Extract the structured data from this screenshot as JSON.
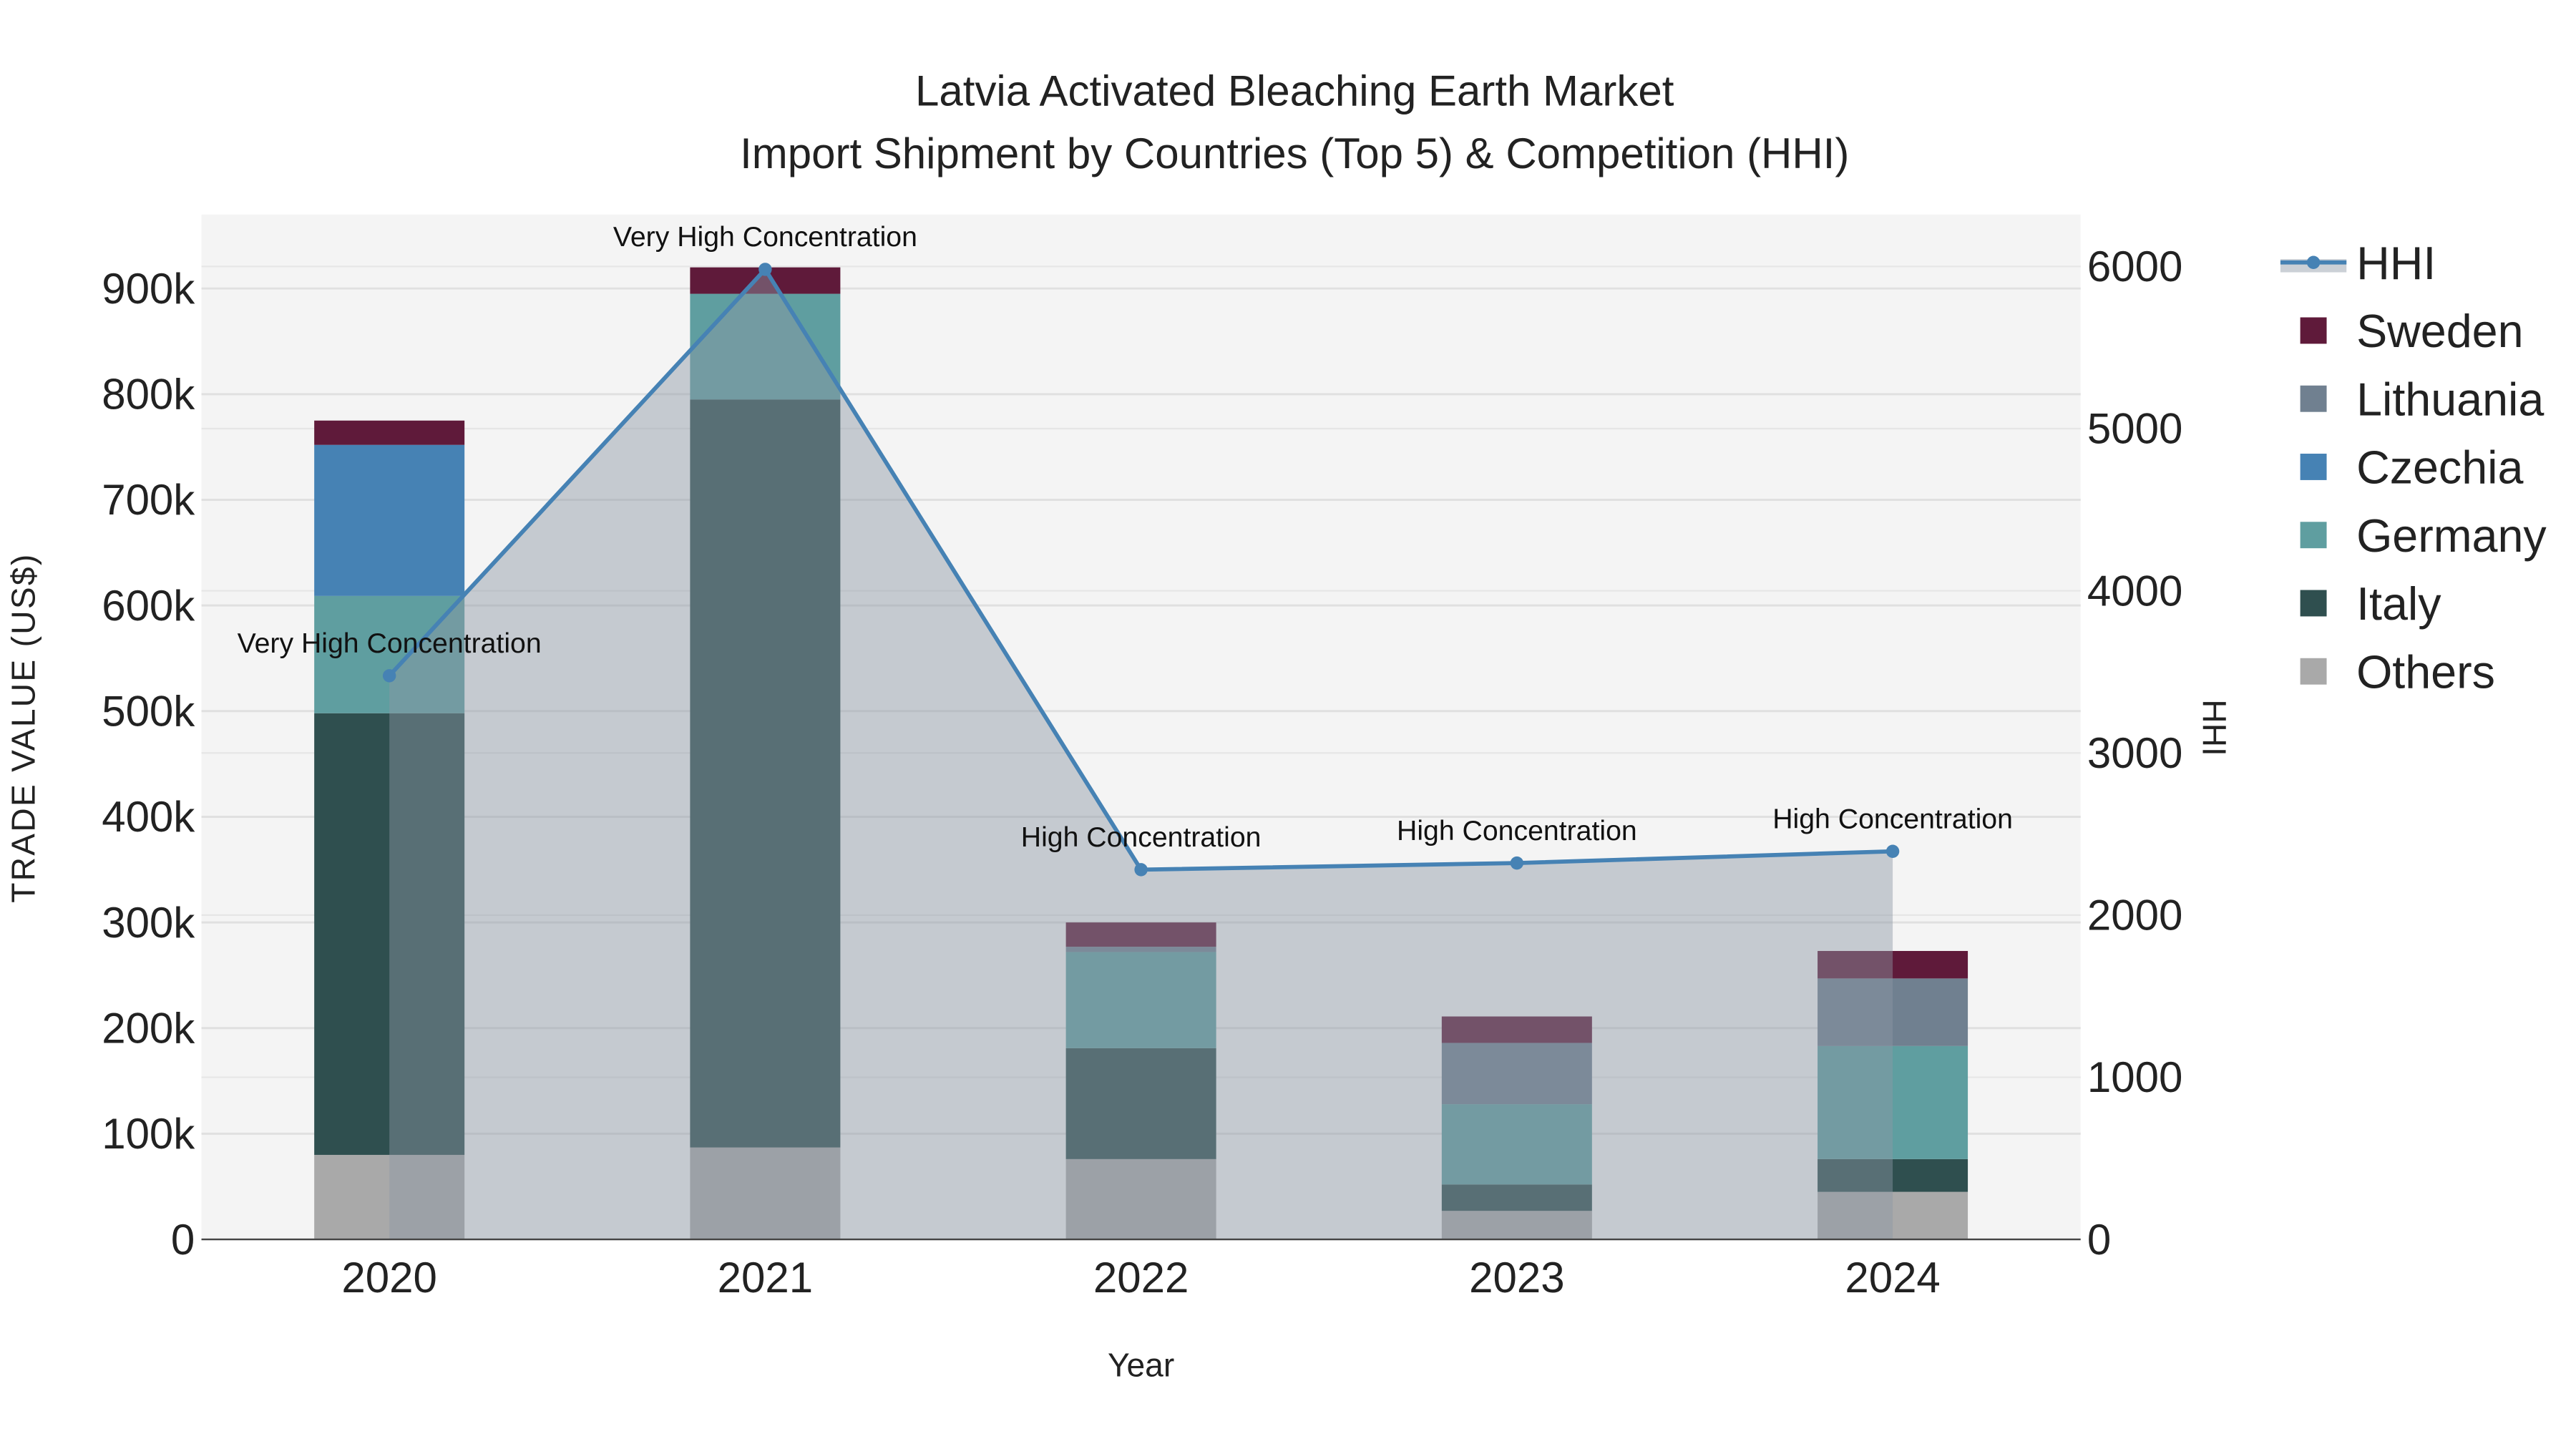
{
  "chart_data": {
    "type": "bar",
    "stacked": true,
    "title": "Latvia Activated Bleaching Earth Market",
    "subtitle": "Import Shipment by Countries (Top 5) & Competition (HHI)",
    "xlabel": "Year",
    "ylabel": "TRADE VALUE (US$)",
    "y2label": "HHI",
    "categories": [
      "2020",
      "2021",
      "2022",
      "2023",
      "2024"
    ],
    "ylim": [
      0,
      970000
    ],
    "y2lim": [
      0,
      6320
    ],
    "yticks": [
      0,
      100000,
      200000,
      300000,
      400000,
      500000,
      600000,
      700000,
      800000,
      900000
    ],
    "ytick_labels": [
      "0",
      "100k",
      "200k",
      "300k",
      "400k",
      "500k",
      "600k",
      "700k",
      "800k",
      "900k"
    ],
    "y2ticks": [
      0,
      1000,
      2000,
      3000,
      4000,
      5000,
      6000
    ],
    "y2tick_labels": [
      "0",
      "1000",
      "2000",
      "3000",
      "4000",
      "5000",
      "6000"
    ],
    "grid": true,
    "legend_position": "right",
    "series": [
      {
        "name": "Others",
        "color": "#a9a9a9",
        "values": [
          80000,
          87000,
          76000,
          27000,
          45000
        ]
      },
      {
        "name": "Italy",
        "color": "#2f4f4f",
        "values": [
          418000,
          708000,
          105000,
          25000,
          31000
        ]
      },
      {
        "name": "Germany",
        "color": "#5f9ea0",
        "values": [
          111000,
          100000,
          91000,
          76000,
          107000
        ]
      },
      {
        "name": "Czechia",
        "color": "#4682b4",
        "values": [
          143000,
          0,
          0,
          0,
          0
        ]
      },
      {
        "name": "Lithuania",
        "color": "#708090",
        "values": [
          0,
          0,
          5000,
          58000,
          64000
        ]
      },
      {
        "name": "Sweden",
        "color": "#5f1a3a",
        "values": [
          23000,
          25000,
          23000,
          25000,
          26000
        ]
      }
    ],
    "hhi": {
      "name": "HHI",
      "color": "#4682b4",
      "values": [
        3476,
        5982,
        2280,
        2321,
        2393
      ],
      "annotations": [
        "Very High Concentration",
        "Very High Concentration",
        "High Concentration",
        "High Concentration",
        "High Concentration"
      ]
    },
    "legend": [
      "HHI",
      "Sweden",
      "Lithuania",
      "Czechia",
      "Germany",
      "Italy",
      "Others"
    ]
  }
}
